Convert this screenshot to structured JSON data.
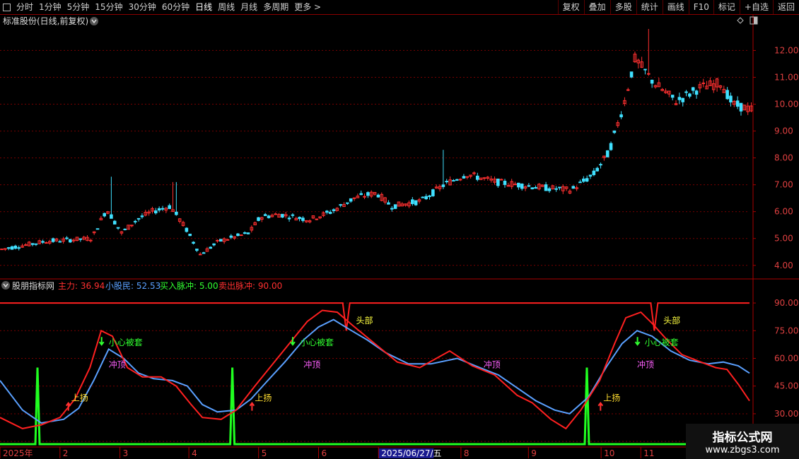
{
  "toolbar": {
    "left_items": [
      "分时",
      "1分钟",
      "5分钟",
      "15分钟",
      "30分钟",
      "60分钟",
      "日线",
      "周线",
      "月线",
      "多周期",
      "更多 >"
    ],
    "active_index": 6,
    "right_items": [
      "复权",
      "叠加",
      "多股",
      "统计",
      "画线",
      "F10",
      "标记",
      "+自选",
      "返回"
    ]
  },
  "price_panel": {
    "title": "标准股份(日线,前复权)",
    "ticks": [
      "12.00",
      "11.00",
      "10.00",
      "9.00",
      "8.00",
      "7.00",
      "6.00",
      "5.00",
      "4.00"
    ],
    "tick_values": [
      12,
      11,
      10,
      9,
      8,
      7,
      6,
      5,
      4
    ]
  },
  "indicator_panel": {
    "name": "股朋指标网",
    "legend": [
      {
        "label": "主力: 36.94",
        "color": "#ff3030"
      },
      {
        "label": "小股民: 52.53",
        "color": "#5aa0ff"
      },
      {
        "label": "买入脉冲: 5.00",
        "color": "#30ff30"
      },
      {
        "label": "卖出脉冲: 90.00",
        "color": "#ff3030"
      }
    ],
    "ticks": [
      "90.00",
      "75.00",
      "60.00",
      "45.00",
      "30.00",
      "15.00"
    ],
    "tick_values": [
      90,
      75,
      60,
      45,
      30,
      15
    ],
    "annotations": [
      {
        "text": "上扬",
        "kind": "up",
        "t": 0.095,
        "v": 37
      },
      {
        "text": "小心被套",
        "kind": "warn",
        "t": 0.145,
        "v": 67
      },
      {
        "text": "冲顶",
        "kind": "top",
        "t": 0.145,
        "v": 55
      },
      {
        "text": "上扬",
        "kind": "up",
        "t": 0.34,
        "v": 37
      },
      {
        "text": "小心被套",
        "kind": "warn",
        "t": 0.4,
        "v": 67
      },
      {
        "text": "冲顶",
        "kind": "top",
        "t": 0.405,
        "v": 55
      },
      {
        "text": "头部",
        "kind": "head",
        "t": 0.475,
        "v": 79
      },
      {
        "text": "冲顶",
        "kind": "top",
        "t": 0.645,
        "v": 55
      },
      {
        "text": "上扬",
        "kind": "up",
        "t": 0.805,
        "v": 37
      },
      {
        "text": "小心被套",
        "kind": "warn",
        "t": 0.86,
        "v": 67
      },
      {
        "text": "冲顶",
        "kind": "top",
        "t": 0.85,
        "v": 55
      },
      {
        "text": "头部",
        "kind": "head",
        "t": 0.885,
        "v": 79
      }
    ]
  },
  "date_axis": {
    "labels": [
      {
        "text": "2025年",
        "t": 0.0
      },
      {
        "text": "2",
        "t": 0.08
      },
      {
        "text": "3",
        "t": 0.16
      },
      {
        "text": "4",
        "t": 0.252
      },
      {
        "text": "5",
        "t": 0.345
      },
      {
        "text": "6",
        "t": 0.425
      },
      {
        "text": "2025/06/27/五",
        "t": 0.505,
        "highlight": true
      },
      {
        "text": "8",
        "t": 0.615
      },
      {
        "text": "9",
        "t": 0.705
      },
      {
        "text": "10",
        "t": 0.802
      },
      {
        "text": "11",
        "t": 0.855
      }
    ]
  },
  "watermark": {
    "title": "指标公式网",
    "url": "www.zbgs3.com"
  },
  "colors": {
    "up": "#ff3030",
    "down": "#40e0ff",
    "grid": "#7a0000",
    "axis": "#aa0000",
    "main": "#ff2020",
    "retail": "#5aa0ff",
    "buy": "#20ff20",
    "sell": "#ff2020"
  },
  "chart_data": [
    {
      "type": "candlestick",
      "title": "标准股份(日线,前复权)",
      "ylim": [
        3.6,
        12.8
      ],
      "x_range": [
        "2025年",
        "11"
      ],
      "price_path": [
        [
          0,
          4.6
        ],
        [
          0.06,
          4.9
        ],
        [
          0.12,
          5.0
        ],
        [
          0.14,
          6.1
        ],
        [
          0.16,
          5.2
        ],
        [
          0.18,
          5.7
        ],
        [
          0.2,
          6.0
        ],
        [
          0.225,
          6.2
        ],
        [
          0.245,
          5.4
        ],
        [
          0.265,
          4.4
        ],
        [
          0.29,
          4.9
        ],
        [
          0.33,
          5.2
        ],
        [
          0.345,
          5.8
        ],
        [
          0.37,
          5.9
        ],
        [
          0.41,
          5.7
        ],
        [
          0.44,
          6.0
        ],
        [
          0.47,
          6.5
        ],
        [
          0.5,
          6.7
        ],
        [
          0.52,
          6.2
        ],
        [
          0.56,
          6.4
        ],
        [
          0.59,
          7.0
        ],
        [
          0.62,
          7.4
        ],
        [
          0.66,
          7.1
        ],
        [
          0.69,
          7.0
        ],
        [
          0.72,
          6.9
        ],
        [
          0.76,
          6.8
        ],
        [
          0.79,
          7.4
        ],
        [
          0.81,
          8.2
        ],
        [
          0.83,
          10.0
        ],
        [
          0.845,
          11.7
        ],
        [
          0.87,
          10.8
        ],
        [
          0.9,
          10.1
        ],
        [
          0.93,
          10.6
        ],
        [
          0.96,
          10.8
        ],
        [
          0.975,
          10.0
        ],
        [
          1,
          9.8
        ]
      ],
      "notable_highs": [
        {
          "t": 0.145,
          "v": 7.3
        },
        {
          "t": 0.23,
          "v": 7.1
        },
        {
          "t": 0.59,
          "v": 8.3
        },
        {
          "t": 0.862,
          "v": 12.8
        }
      ]
    },
    {
      "type": "line",
      "ylim": [
        12,
        95
      ],
      "series": [
        {
          "name": "主力",
          "last": 36.94,
          "path": [
            [
              0,
              28
            ],
            [
              0.03,
              22
            ],
            [
              0.055,
              24
            ],
            [
              0.08,
              28
            ],
            [
              0.1,
              38
            ],
            [
              0.12,
              55
            ],
            [
              0.135,
              75
            ],
            [
              0.15,
              72
            ],
            [
              0.17,
              55
            ],
            [
              0.19,
              50
            ],
            [
              0.215,
              50
            ],
            [
              0.235,
              45
            ],
            [
              0.255,
              35
            ],
            [
              0.27,
              28
            ],
            [
              0.295,
              27
            ],
            [
              0.315,
              32
            ],
            [
              0.34,
              45
            ],
            [
              0.37,
              60
            ],
            [
              0.39,
              70
            ],
            [
              0.41,
              80
            ],
            [
              0.43,
              86
            ],
            [
              0.45,
              85
            ],
            [
              0.47,
              78
            ],
            [
              0.5,
              68
            ],
            [
              0.53,
              58
            ],
            [
              0.56,
              55
            ],
            [
              0.6,
              64
            ],
            [
              0.63,
              56
            ],
            [
              0.66,
              51
            ],
            [
              0.69,
              40
            ],
            [
              0.71,
              36
            ],
            [
              0.735,
              27
            ],
            [
              0.755,
              22
            ],
            [
              0.775,
              32
            ],
            [
              0.8,
              48
            ],
            [
              0.82,
              68
            ],
            [
              0.835,
              82
            ],
            [
              0.855,
              85
            ],
            [
              0.87,
              79
            ],
            [
              0.89,
              70
            ],
            [
              0.91,
              62
            ],
            [
              0.935,
              58
            ],
            [
              0.955,
              55
            ],
            [
              0.97,
              54
            ],
            [
              0.985,
              46
            ],
            [
              1,
              37
            ]
          ]
        },
        {
          "name": "小股民",
          "last": 52.53,
          "path": [
            [
              0,
              48
            ],
            [
              0.03,
              32
            ],
            [
              0.055,
              25
            ],
            [
              0.085,
              27
            ],
            [
              0.105,
              33
            ],
            [
              0.125,
              48
            ],
            [
              0.145,
              65
            ],
            [
              0.165,
              60
            ],
            [
              0.185,
              52
            ],
            [
              0.205,
              49
            ],
            [
              0.23,
              48
            ],
            [
              0.25,
              45
            ],
            [
              0.27,
              35
            ],
            [
              0.29,
              31
            ],
            [
              0.315,
              32
            ],
            [
              0.335,
              38
            ],
            [
              0.355,
              47
            ],
            [
              0.38,
              58
            ],
            [
              0.405,
              70
            ],
            [
              0.425,
              77
            ],
            [
              0.445,
              81
            ],
            [
              0.465,
              76
            ],
            [
              0.49,
              70
            ],
            [
              0.515,
              63
            ],
            [
              0.545,
              57
            ],
            [
              0.575,
              57
            ],
            [
              0.61,
              60
            ],
            [
              0.64,
              55
            ],
            [
              0.665,
              51
            ],
            [
              0.69,
              44
            ],
            [
              0.715,
              37
            ],
            [
              0.74,
              32
            ],
            [
              0.76,
              30
            ],
            [
              0.785,
              39
            ],
            [
              0.81,
              56
            ],
            [
              0.83,
              68
            ],
            [
              0.85,
              75
            ],
            [
              0.87,
              72
            ],
            [
              0.895,
              64
            ],
            [
              0.92,
              59
            ],
            [
              0.945,
              57
            ],
            [
              0.965,
              58
            ],
            [
              0.985,
              56
            ],
            [
              1,
              52
            ]
          ]
        },
        {
          "name": "买入脉冲",
          "last": 5.0,
          "spikes_at": [
            0.05,
            0.31,
            0.783
          ]
        },
        {
          "name": "卖出脉冲",
          "last": 90.0,
          "dips_at": [
            0.462,
            0.873
          ]
        }
      ]
    }
  ]
}
